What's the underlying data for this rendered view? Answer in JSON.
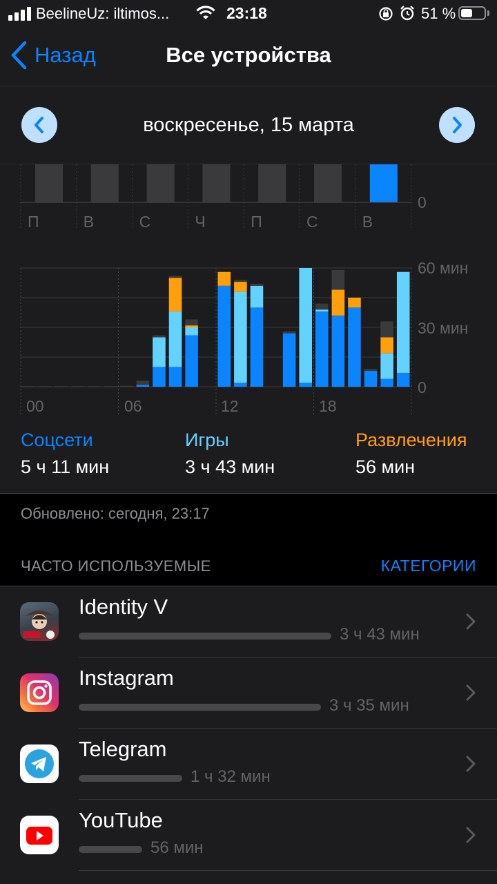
{
  "status_bar": {
    "carrier": "BeelineUz: iltimos...",
    "time": "23:18",
    "battery_percent": "51 %",
    "battery_level": 0.51
  },
  "nav": {
    "back_label": "Назад",
    "title": "Все устройства"
  },
  "date_bar": {
    "date_label": "воскресенье, 15 марта"
  },
  "weekly": {
    "days": [
      "П",
      "В",
      "С",
      "Ч",
      "П",
      "С",
      "В"
    ],
    "zero_label": "0",
    "selected_index": 6
  },
  "chart_data": {
    "type": "bar",
    "stacked": true,
    "ylim": [
      0,
      60
    ],
    "y_ticks": [
      "0",
      "30 мин",
      "60 мин"
    ],
    "x_tick_labels": [
      "00",
      "06",
      "12",
      "18"
    ],
    "hours": [
      0,
      1,
      2,
      3,
      4,
      5,
      6,
      7,
      8,
      9,
      10,
      11,
      12,
      13,
      14,
      15,
      16,
      17,
      18,
      19,
      20,
      21,
      22,
      23
    ],
    "colors": {
      "social": "#0a84ff",
      "games": "#64d2ff",
      "entertainment": "#ff9f0a",
      "other": "#3a3a3c"
    },
    "series": [
      {
        "name": "Соцсети",
        "key": "social",
        "values": [
          0,
          0,
          0,
          0,
          0,
          0,
          0,
          1,
          10,
          10,
          26,
          0,
          51,
          2,
          40,
          0,
          27,
          2,
          38,
          36,
          40,
          8,
          4,
          7
        ]
      },
      {
        "name": "Игры",
        "key": "games",
        "values": [
          0,
          0,
          0,
          0,
          0,
          0,
          0,
          0,
          15,
          28,
          4,
          0,
          0,
          46,
          11,
          0,
          0,
          58,
          1,
          0,
          0,
          0,
          13,
          51
        ]
      },
      {
        "name": "Развлечения",
        "key": "entertainment",
        "values": [
          0,
          0,
          0,
          0,
          0,
          0,
          0,
          0,
          0,
          17,
          1,
          0,
          7,
          5,
          0,
          0,
          0,
          0,
          0,
          13,
          5,
          0,
          8,
          0
        ]
      },
      {
        "name": "",
        "key": "other",
        "values": [
          0.3,
          0.3,
          0.3,
          0.3,
          0.3,
          0.3,
          0.5,
          2,
          1,
          1,
          3,
          0,
          0,
          1,
          1,
          0,
          1,
          0,
          3,
          10,
          0,
          1,
          8,
          0
        ]
      }
    ]
  },
  "summary": [
    {
      "label": "Соцсети",
      "value": "5 ч 11 мин",
      "color": "#0a84ff"
    },
    {
      "label": "Игры",
      "value": "3 ч 43 мин",
      "color": "#64d2ff"
    },
    {
      "label": "Развлечения",
      "value": "56 мин",
      "color": "#ff9f0a"
    }
  ],
  "updated": "Обновлено: сегодня, 23:17",
  "most_used": {
    "header": "ЧАСТО ИСПОЛЬЗУЕМЫЕ",
    "categories_link": "КАТЕГОРИИ",
    "apps": [
      {
        "name": "Identity V",
        "time": "3 ч 43 мин",
        "fraction": 1.0,
        "icon": "identity-v-icon"
      },
      {
        "name": "Instagram",
        "time": "3 ч 35 мин",
        "fraction": 0.96,
        "icon": "instagram-icon"
      },
      {
        "name": "Telegram",
        "time": "1 ч 32 мин",
        "fraction": 0.41,
        "icon": "telegram-icon"
      },
      {
        "name": "YouTube",
        "time": "56 мин",
        "fraction": 0.25,
        "icon": "youtube-icon"
      }
    ]
  }
}
